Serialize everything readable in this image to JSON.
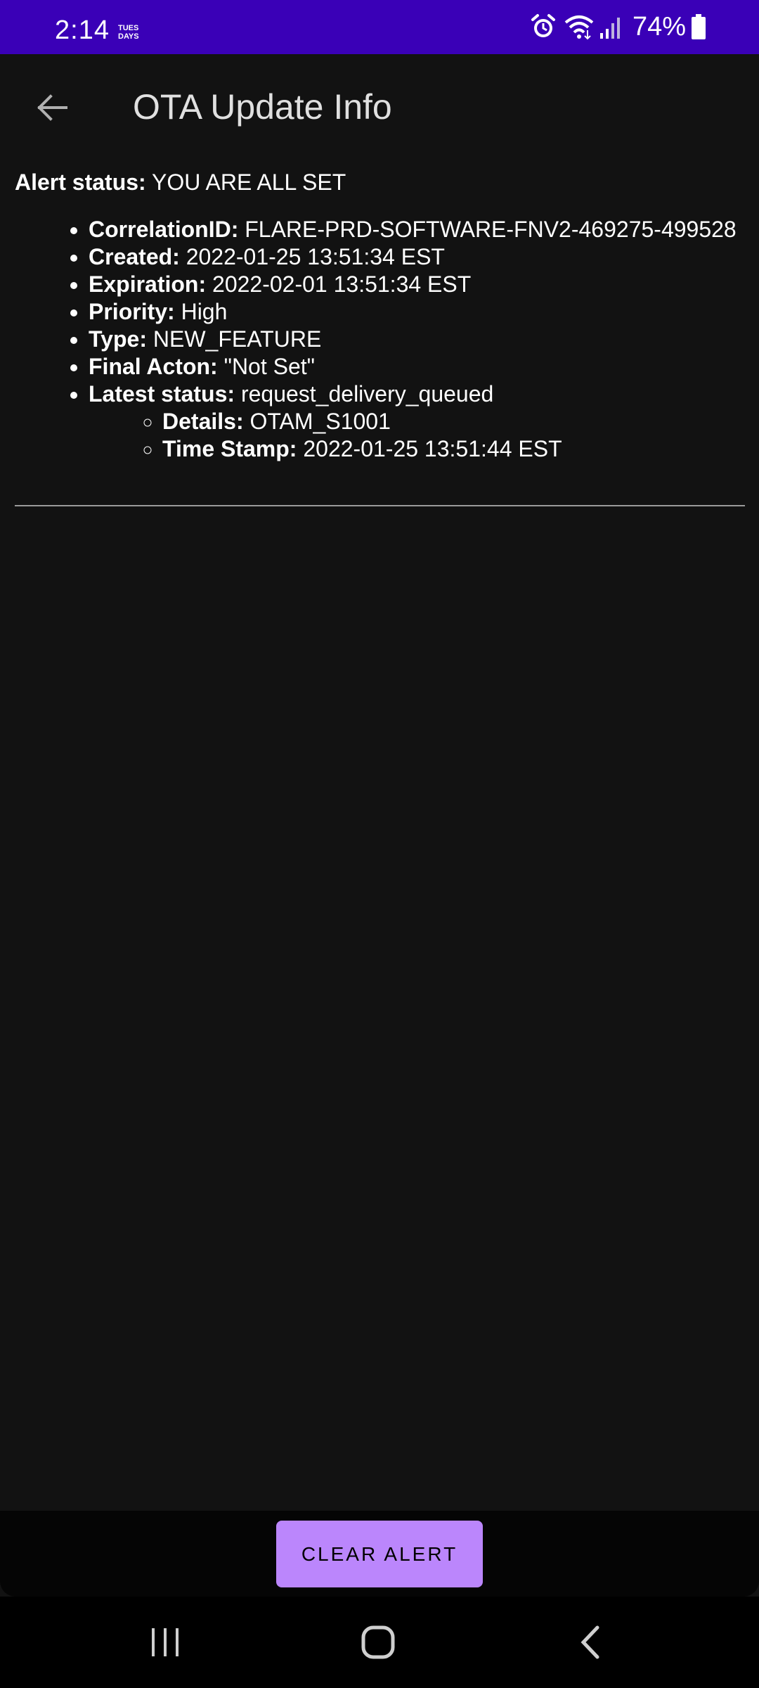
{
  "status_bar": {
    "time": "2:14",
    "note_badge": "TUES DAYS",
    "battery_percent": "74%",
    "icons": [
      "alarm-icon",
      "wifi-icon",
      "signal-icon",
      "battery-icon"
    ],
    "background": "#3a00b7"
  },
  "app_bar": {
    "title": "OTA Update Info",
    "back_icon": "arrow-left-icon"
  },
  "alert": {
    "status_label": "Alert status:",
    "status_value": "YOU ARE ALL SET",
    "items": [
      {
        "label": "CorrelationID:",
        "value": "FLARE-PRD-SOFTWARE-FNV2-469275-499528"
      },
      {
        "label": "Created:",
        "value": "2022-01-25 13:51:34 EST"
      },
      {
        "label": "Expiration:",
        "value": "2022-02-01 13:51:34 EST"
      },
      {
        "label": "Priority:",
        "value": "High"
      },
      {
        "label": "Type:",
        "value": "NEW_FEATURE"
      },
      {
        "label": "Final Acton:",
        "value": "\"Not Set\""
      },
      {
        "label": "Latest status:",
        "value": "request_delivery_queued"
      }
    ],
    "sub_items": [
      {
        "label": "Details:",
        "value": "OTAM_S1001"
      },
      {
        "label": "Time Stamp:",
        "value": "2022-01-25 13:51:44 EST"
      }
    ]
  },
  "actions": {
    "clear_label": "CLEAR ALERT",
    "accent": "#bb86fc"
  },
  "nav_bar": {
    "icons": [
      "recent-apps-icon",
      "home-icon",
      "back-icon"
    ]
  }
}
